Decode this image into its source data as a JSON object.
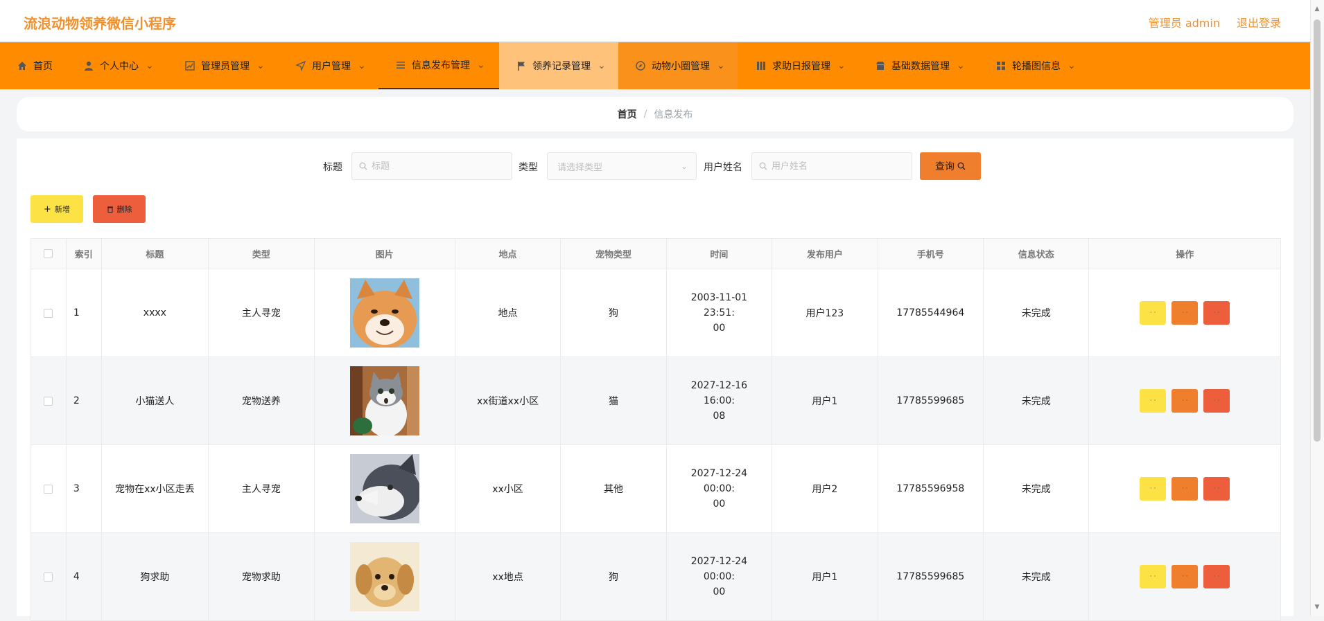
{
  "header": {
    "app_title": "流浪动物领养微信小程序",
    "admin_label": "管理员 admin",
    "logout_label": "退出登录"
  },
  "nav": {
    "items": [
      {
        "label": "首页",
        "icon": "home-icon"
      },
      {
        "label": "个人中心",
        "icon": "user-icon"
      },
      {
        "label": "管理员管理",
        "icon": "chart-icon"
      },
      {
        "label": "用户管理",
        "icon": "send-icon"
      },
      {
        "label": "信息发布管理",
        "icon": "list-icon"
      },
      {
        "label": "领养记录管理",
        "icon": "flag-icon"
      },
      {
        "label": "动物小圈管理",
        "icon": "compass-icon"
      },
      {
        "label": "求助日报管理",
        "icon": "grid-icon"
      },
      {
        "label": "基础数据管理",
        "icon": "shop-icon"
      },
      {
        "label": "轮播图信息",
        "icon": "apps-icon"
      }
    ]
  },
  "breadcrumb": {
    "home": "首页",
    "separator": "/",
    "current": "信息发布"
  },
  "search": {
    "title_label": "标题",
    "title_placeholder": "标题",
    "type_label": "类型",
    "type_placeholder": "请选择类型",
    "username_label": "用户姓名",
    "username_placeholder": "用户姓名",
    "query_label": "查询"
  },
  "actions": {
    "add_label": "新增",
    "delete_label": "删除"
  },
  "table": {
    "headers": [
      "索引",
      "标题",
      "类型",
      "图片",
      "地点",
      "宠物类型",
      "时间",
      "发布用户",
      "手机号",
      "信息状态",
      "操作"
    ],
    "rows": [
      {
        "index": "1",
        "title": "xxxx",
        "type": "主人寻宠",
        "image": "shiba-dog",
        "location": "地点",
        "pet_type": "狗",
        "time_line1": "2003-11-01 23:51:",
        "time_line2": "00",
        "user": "用户123",
        "phone": "17785544964",
        "status": "未完成"
      },
      {
        "index": "2",
        "title": "小猫送人",
        "type": "宠物送养",
        "image": "cat",
        "location": "xx街道xx小区",
        "pet_type": "猫",
        "time_line1": "2027-12-16 16:00:",
        "time_line2": "08",
        "user": "用户1",
        "phone": "17785599685",
        "status": "未完成"
      },
      {
        "index": "3",
        "title": "宠物在xx小区走丢",
        "type": "主人寻宠",
        "image": "husky",
        "location": "xx小区",
        "pet_type": "其他",
        "time_line1": "2027-12-24 00:00:",
        "time_line2": "00",
        "user": "用户2",
        "phone": "17785596958",
        "status": "未完成"
      },
      {
        "index": "4",
        "title": "狗求助",
        "type": "宠物求助",
        "image": "puppy",
        "location": "xx地点",
        "pet_type": "狗",
        "time_line1": "2027-12-24 00:00:",
        "time_line2": "00",
        "user": "用户1",
        "phone": "17785599685",
        "status": "未完成"
      }
    ]
  },
  "colors": {
    "accent": "#ff8c00",
    "title": "#f0912f",
    "yellow_btn": "#fde246",
    "orange_btn": "#f07f2d",
    "red_btn": "#ed5e3c"
  }
}
